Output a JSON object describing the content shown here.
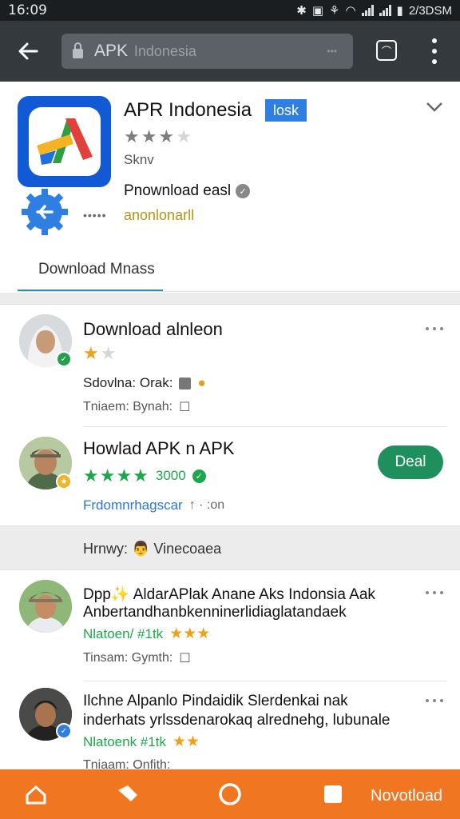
{
  "status_bar": {
    "time": "16:09",
    "right_text": "2/3DSM"
  },
  "toolbar": {
    "url_text": "APK",
    "url_text_dim": "Indonesia",
    "url_suffix": "•••"
  },
  "app": {
    "title": "APR Indonesia",
    "badge": "losk",
    "rating_stars": 3,
    "size_text": "Sknv",
    "download_text": "Pnownload easl",
    "developer_link": "anonlonarll",
    "more_dots": "•••••",
    "tab_label": "Download Mnass"
  },
  "list1": [
    {
      "title": "Download alnleon",
      "stars_filled": 1,
      "stars_total": 2,
      "meta1": "Sdovlna: Orak:",
      "meta2": "Tniaem: Bynah:"
    },
    {
      "title": "Howlad APK n APK",
      "stars_filled": 4,
      "rating_value": "3000",
      "link_text": "Frdomnrhagscar",
      "link_suffix": "↑ · :on",
      "button_label": "Deal"
    }
  ],
  "section_label": "Hrnwy: 👨 Vinecoaea",
  "list2": [
    {
      "title_line1": "Dpp✨ AldarAPlak Anane Aks Indonsia Aak",
      "title_line2": "Anbertandhanbkenninerlidiaglatandaek",
      "tag_text": "Nlatoen/ #1tk",
      "meta": "Tinsam: Gymth:"
    },
    {
      "title_line1": "Ilchne Alpanlo Pindaidik Slerdenkai nak",
      "title_line2": "inderhats yrlssdenarokaq alrednehg, lubunale",
      "tag_text": "Nlatoenk #1tk",
      "meta": "Tniaam: Onfith:"
    }
  ],
  "bottom_nav": {
    "label": "Novotload"
  }
}
